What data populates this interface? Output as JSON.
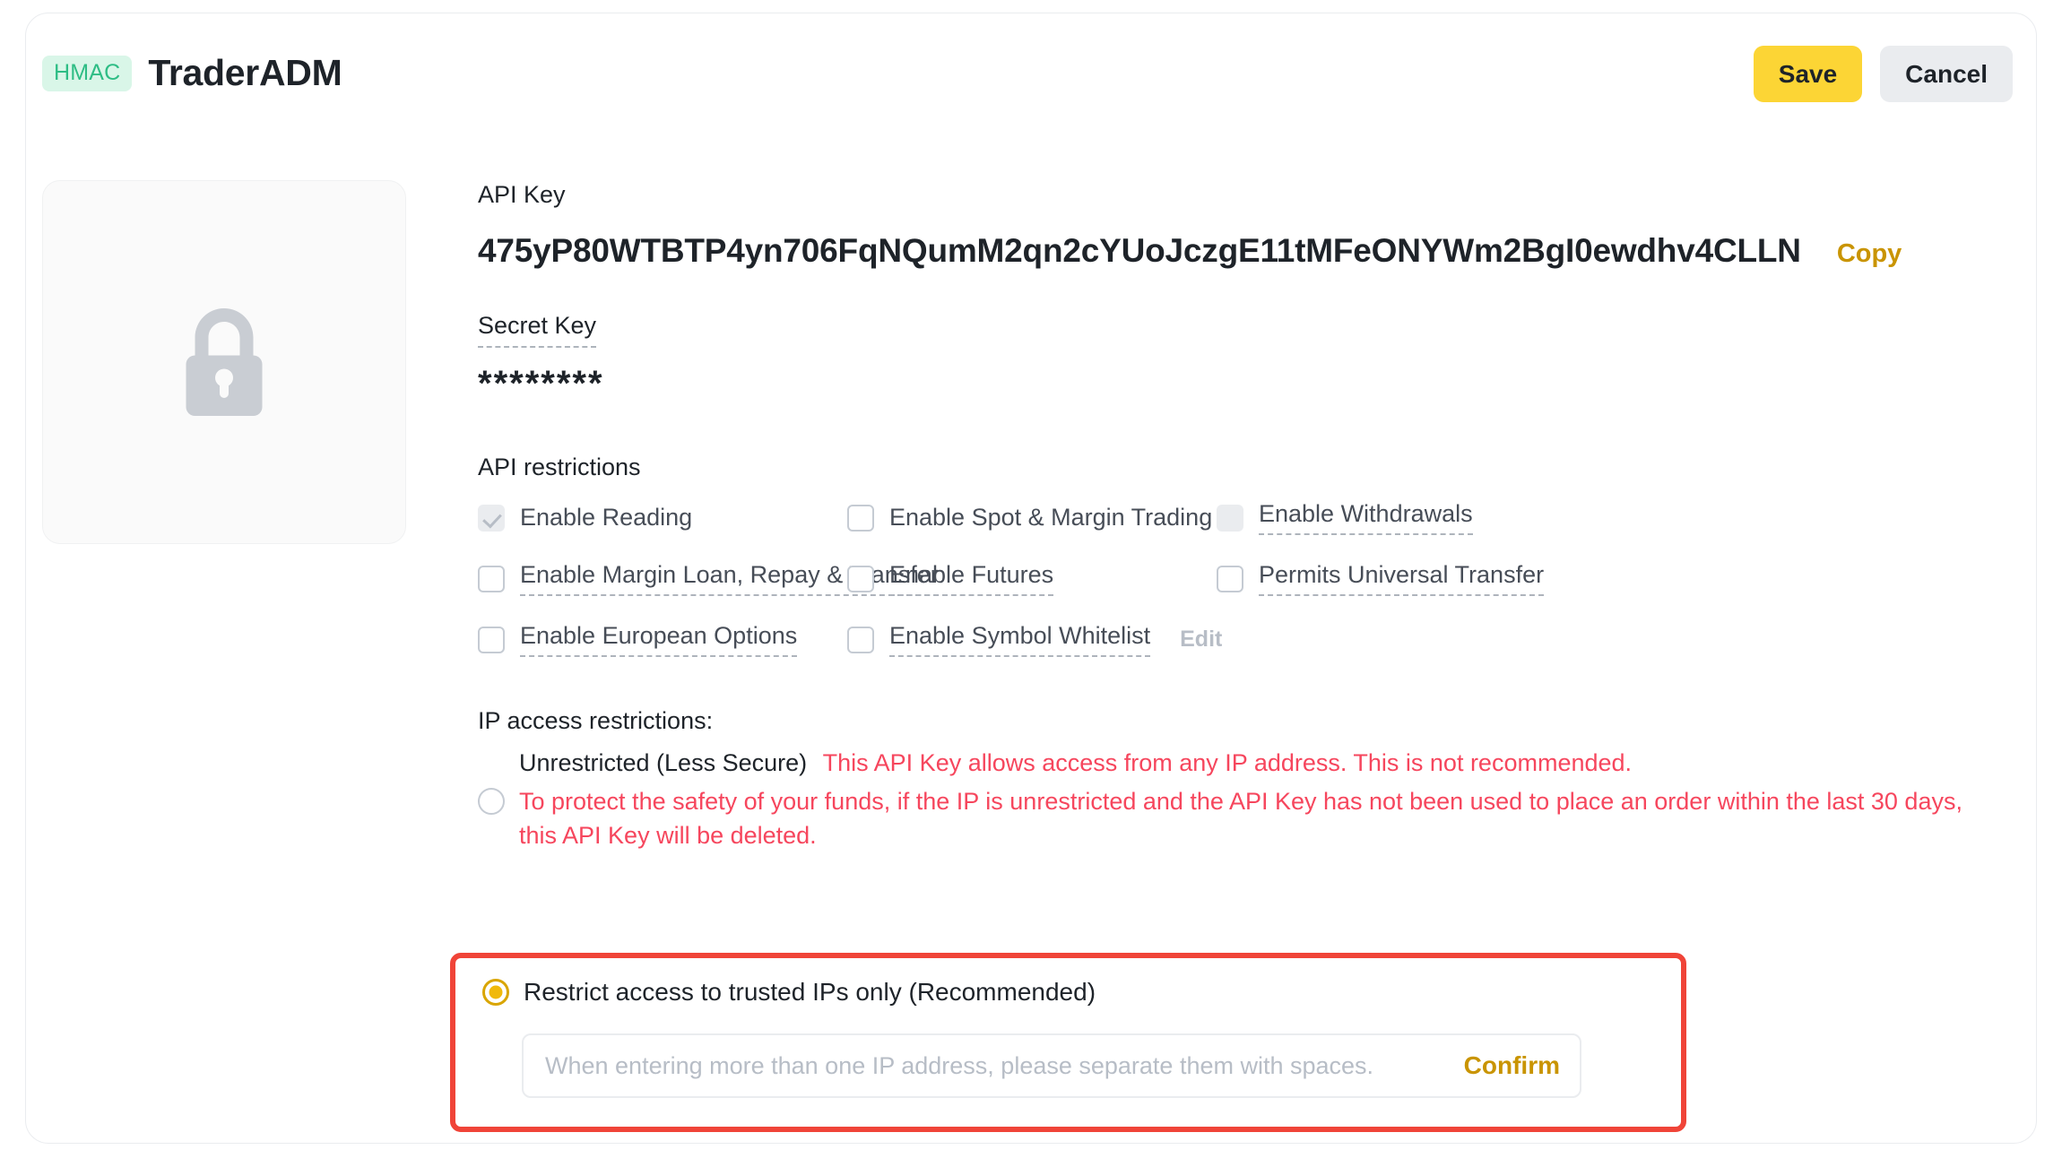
{
  "header": {
    "badge": "HMAC",
    "title": "TraderADM",
    "save_label": "Save",
    "cancel_label": "Cancel"
  },
  "qr": {
    "icon": "lock-icon"
  },
  "api_key": {
    "label": "API Key",
    "value": "475yP80WTBTP4yn706FqNQumM2qn2cYUoJczgE11tMFeONYWm2BgI0ewdhv4CLLN",
    "copy_label": "Copy"
  },
  "secret_key": {
    "label": "Secret Key",
    "value": "********"
  },
  "restrictions": {
    "title": "API restrictions",
    "items": [
      {
        "label": "Enable Reading",
        "checked": true,
        "disabled": true,
        "dashed": false
      },
      {
        "label": "Enable Spot & Margin Trading",
        "checked": false,
        "disabled": false,
        "dashed": false
      },
      {
        "label": "Enable Withdrawals",
        "checked": false,
        "disabled": true,
        "dashed": true
      },
      {
        "label": "Enable Margin Loan, Repay & Transfer",
        "checked": false,
        "disabled": false,
        "dashed": true
      },
      {
        "label": "Enable Futures",
        "checked": false,
        "disabled": false,
        "dashed": true
      },
      {
        "label": "Permits Universal Transfer",
        "checked": false,
        "disabled": false,
        "dashed": true
      },
      {
        "label": "Enable European Options",
        "checked": false,
        "disabled": false,
        "dashed": true
      },
      {
        "label": "Enable Symbol Whitelist",
        "checked": false,
        "disabled": false,
        "dashed": true,
        "action": "Edit"
      }
    ]
  },
  "ip_access": {
    "title": "IP access restrictions:",
    "unrestricted": {
      "label": "Unrestricted (Less Secure)",
      "warning": "This API Key allows access from any IP address. This is not recommended.",
      "note": "To protect the safety of your funds, if the IP is unrestricted and the API Key has not been used to place an order within the last 30 days, this API Key will be deleted.",
      "selected": false
    },
    "trusted": {
      "label": "Restrict access to trusted IPs only (Recommended)",
      "selected": true,
      "input_value": "",
      "input_placeholder": "When entering more than one IP address, please separate them with spaces.",
      "confirm_label": "Confirm"
    }
  },
  "colors": {
    "accent_yellow": "#FCD535",
    "link_gold": "#C99400",
    "danger_red": "#F6465D",
    "highlight_red": "#F04438",
    "badge_green": "#2EBD85",
    "badge_green_bg": "#D9F6E8"
  }
}
